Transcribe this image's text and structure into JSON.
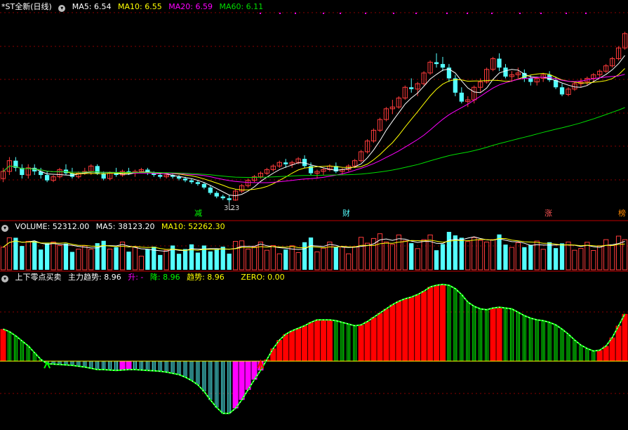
{
  "colors": {
    "up": "#ff3b3b",
    "down": "#54ffff",
    "ma5": "#ffffff",
    "ma10": "#ffff00",
    "ma20": "#ff00ff",
    "ma60": "#00dd00",
    "grid": "#8a0000",
    "border": "#c00000",
    "magenta": "#ff00ff",
    "green": "#00ff00",
    "red": "#ff0000",
    "cyanbar": "#5ff"
  },
  "header_price": {
    "title": "*ST全新(日线)",
    "ma5": "MA5: 6.54",
    "ma10": "MA10: 6.55",
    "ma20": "MA20: 6.59",
    "ma60": "MA60: 6.11"
  },
  "header_volume": {
    "title": "VOLUME: 52312.00",
    "ma5": "MA5: 38123.20",
    "ma10": "MA10: 52262.30"
  },
  "header_indicator": {
    "title": "上下零点买卖",
    "main": "主力趋势: 8.96",
    "up": "升: -",
    "down": "降: 8.96",
    "trend": "趋势: 8.96",
    "zero": "ZERO: 0.00"
  },
  "markers": {
    "jian": "减",
    "cai": "财",
    "zhang": "涨",
    "bang": "榜",
    "low_label": "3.23"
  },
  "chart_data": [
    {
      "type": "candlestick",
      "panel": "price",
      "y_low_label": 3.23,
      "series_names": [
        "MA5",
        "MA10",
        "MA20",
        "MA60"
      ],
      "ohlc": [
        [
          3.9,
          4.2,
          3.8,
          4.1
        ],
        [
          4.1,
          4.5,
          4.0,
          4.4
        ],
        [
          4.4,
          4.5,
          4.1,
          4.2
        ],
        [
          4.2,
          4.3,
          3.9,
          4.0
        ],
        [
          4.0,
          4.3,
          3.9,
          4.2
        ],
        [
          4.2,
          4.3,
          4.0,
          4.1
        ],
        [
          4.1,
          4.2,
          3.9,
          4.0
        ],
        [
          4.0,
          4.1,
          3.8,
          3.85
        ],
        [
          3.85,
          4.0,
          3.8,
          3.95
        ],
        [
          3.95,
          4.2,
          3.9,
          4.15
        ],
        [
          4.15,
          4.3,
          4.0,
          4.05
        ],
        [
          4.05,
          4.2,
          3.9,
          3.95
        ],
        [
          3.95,
          4.1,
          3.9,
          4.05
        ],
        [
          4.05,
          4.2,
          4.0,
          4.1
        ],
        [
          4.1,
          4.3,
          4.0,
          4.25
        ],
        [
          4.25,
          4.3,
          4.0,
          4.05
        ],
        [
          4.05,
          4.1,
          3.85,
          3.9
        ],
        [
          3.9,
          4.1,
          3.85,
          4.05
        ],
        [
          4.05,
          4.2,
          3.95,
          4.0
        ],
        [
          4.0,
          4.15,
          3.95,
          4.1
        ],
        [
          4.1,
          4.2,
          4.0,
          4.05
        ],
        [
          4.05,
          4.15,
          3.95,
          4.1
        ],
        [
          4.1,
          4.2,
          4.05,
          4.15
        ],
        [
          4.15,
          4.2,
          4.0,
          4.05
        ],
        [
          4.05,
          4.1,
          3.95,
          4.0
        ],
        [
          4.0,
          4.05,
          3.9,
          3.95
        ],
        [
          3.95,
          4.05,
          3.9,
          4.0
        ],
        [
          4.0,
          4.05,
          3.9,
          3.95
        ],
        [
          3.95,
          4.0,
          3.85,
          3.9
        ],
        [
          3.9,
          3.95,
          3.8,
          3.85
        ],
        [
          3.85,
          3.9,
          3.75,
          3.8
        ],
        [
          3.8,
          3.85,
          3.7,
          3.75
        ],
        [
          3.75,
          3.8,
          3.6,
          3.65
        ],
        [
          3.65,
          3.7,
          3.45,
          3.5
        ],
        [
          3.5,
          3.55,
          3.35,
          3.4
        ],
        [
          3.4,
          3.45,
          3.3,
          3.35
        ],
        [
          3.35,
          3.45,
          3.23,
          3.3
        ],
        [
          3.3,
          3.6,
          3.28,
          3.55
        ],
        [
          3.55,
          3.75,
          3.5,
          3.7
        ],
        [
          3.7,
          3.9,
          3.65,
          3.85
        ],
        [
          3.85,
          4.0,
          3.8,
          3.95
        ],
        [
          3.95,
          4.1,
          3.9,
          4.05
        ],
        [
          4.05,
          4.2,
          4.0,
          4.15
        ],
        [
          4.15,
          4.3,
          4.1,
          4.25
        ],
        [
          4.25,
          4.4,
          4.2,
          4.35
        ],
        [
          4.35,
          4.45,
          4.2,
          4.3
        ],
        [
          4.3,
          4.4,
          4.2,
          4.35
        ],
        [
          4.35,
          4.5,
          4.3,
          4.45
        ],
        [
          4.45,
          4.55,
          4.2,
          4.25
        ],
        [
          4.25,
          4.35,
          4.0,
          4.05
        ],
        [
          4.05,
          4.15,
          3.9,
          4.1
        ],
        [
          4.1,
          4.2,
          4.0,
          4.15
        ],
        [
          4.15,
          4.3,
          4.1,
          4.25
        ],
        [
          4.25,
          4.35,
          4.05,
          4.1
        ],
        [
          4.1,
          4.2,
          4.0,
          4.15
        ],
        [
          4.15,
          4.3,
          4.1,
          4.25
        ],
        [
          4.25,
          4.45,
          4.2,
          4.4
        ],
        [
          4.4,
          4.7,
          4.35,
          4.65
        ],
        [
          4.65,
          5.0,
          4.6,
          4.95
        ],
        [
          4.95,
          5.3,
          4.9,
          5.25
        ],
        [
          5.25,
          5.6,
          5.2,
          5.55
        ],
        [
          5.55,
          5.9,
          5.5,
          5.85
        ],
        [
          5.85,
          6.1,
          5.7,
          5.9
        ],
        [
          5.9,
          6.2,
          5.85,
          6.15
        ],
        [
          6.15,
          6.5,
          6.1,
          6.45
        ],
        [
          6.45,
          6.7,
          6.3,
          6.4
        ],
        [
          6.4,
          6.6,
          6.2,
          6.55
        ],
        [
          6.55,
          6.9,
          6.5,
          6.85
        ],
        [
          6.85,
          7.2,
          6.8,
          7.15
        ],
        [
          7.15,
          7.4,
          7.0,
          7.1
        ],
        [
          7.1,
          7.3,
          6.9,
          7.0
        ],
        [
          7.0,
          7.1,
          6.6,
          6.7
        ],
        [
          6.7,
          6.8,
          6.2,
          6.3
        ],
        [
          6.3,
          6.45,
          6.0,
          6.05
        ],
        [
          6.05,
          6.2,
          5.9,
          6.1
        ],
        [
          6.1,
          6.5,
          6.0,
          6.45
        ],
        [
          6.45,
          6.7,
          6.3,
          6.6
        ],
        [
          6.6,
          7.0,
          6.55,
          6.95
        ],
        [
          6.95,
          7.3,
          6.9,
          7.25
        ],
        [
          7.25,
          7.4,
          6.9,
          7.0
        ],
        [
          7.0,
          7.1,
          6.7,
          6.75
        ],
        [
          6.75,
          6.9,
          6.6,
          6.8
        ],
        [
          6.8,
          7.0,
          6.7,
          6.85
        ],
        [
          6.85,
          6.95,
          6.6,
          6.7
        ],
        [
          6.7,
          6.8,
          6.5,
          6.6
        ],
        [
          6.6,
          6.75,
          6.5,
          6.7
        ],
        [
          6.7,
          6.85,
          6.6,
          6.8
        ],
        [
          6.8,
          6.9,
          6.6,
          6.65
        ],
        [
          6.65,
          6.75,
          6.4,
          6.45
        ],
        [
          6.45,
          6.55,
          6.2,
          6.25
        ],
        [
          6.25,
          6.45,
          6.2,
          6.4
        ],
        [
          6.4,
          6.6,
          6.35,
          6.55
        ],
        [
          6.55,
          6.7,
          6.45,
          6.6
        ],
        [
          6.6,
          6.75,
          6.5,
          6.7
        ],
        [
          6.7,
          6.85,
          6.6,
          6.8
        ],
        [
          6.8,
          6.95,
          6.7,
          6.9
        ],
        [
          6.9,
          7.1,
          6.85,
          7.05
        ],
        [
          7.05,
          7.3,
          7.0,
          7.25
        ],
        [
          7.25,
          7.6,
          7.2,
          7.55
        ],
        [
          7.55,
          8.0,
          7.5,
          7.95
        ]
      ]
    },
    {
      "type": "bar",
      "panel": "volume",
      "series_names": [
        "VOLUME",
        "MA5",
        "MA10"
      ]
    },
    {
      "type": "bar",
      "panel": "indicator",
      "series_names": [
        "主力趋势",
        "升",
        "降",
        "趋势",
        "ZERO"
      ],
      "values": [
        3.8,
        3.5,
        3.0,
        2.4,
        1.8,
        1.0,
        0.2,
        -0.3,
        -0.35,
        -0.4,
        -0.45,
        -0.5,
        -0.6,
        -0.7,
        -0.85,
        -1.0,
        -1.0,
        -1.05,
        -1.1,
        -1.05,
        -1.0,
        -1.0,
        -1.05,
        -1.1,
        -1.15,
        -1.2,
        -1.3,
        -1.45,
        -1.6,
        -1.9,
        -2.3,
        -2.8,
        -3.6,
        -4.6,
        -5.5,
        -6.2,
        -6.2,
        -5.6,
        -4.6,
        -3.4,
        -2.2,
        -1.1,
        0.2,
        1.5,
        2.5,
        3.2,
        3.6,
        3.9,
        4.2,
        4.6,
        4.9,
        4.9,
        4.9,
        4.8,
        4.6,
        4.4,
        4.2,
        4.3,
        4.7,
        5.2,
        5.7,
        6.2,
        6.7,
        7.1,
        7.4,
        7.6,
        7.9,
        8.3,
        8.8,
        9.0,
        9.1,
        9.0,
        8.6,
        7.9,
        7.0,
        6.5,
        6.2,
        6.1,
        6.3,
        6.4,
        6.3,
        6.2,
        5.8,
        5.4,
        5.1,
        4.9,
        4.8,
        4.6,
        4.3,
        3.8,
        3.2,
        2.5,
        1.9,
        1.5,
        1.2,
        1.3,
        1.8,
        2.8,
        4.2,
        5.6
      ]
    }
  ]
}
